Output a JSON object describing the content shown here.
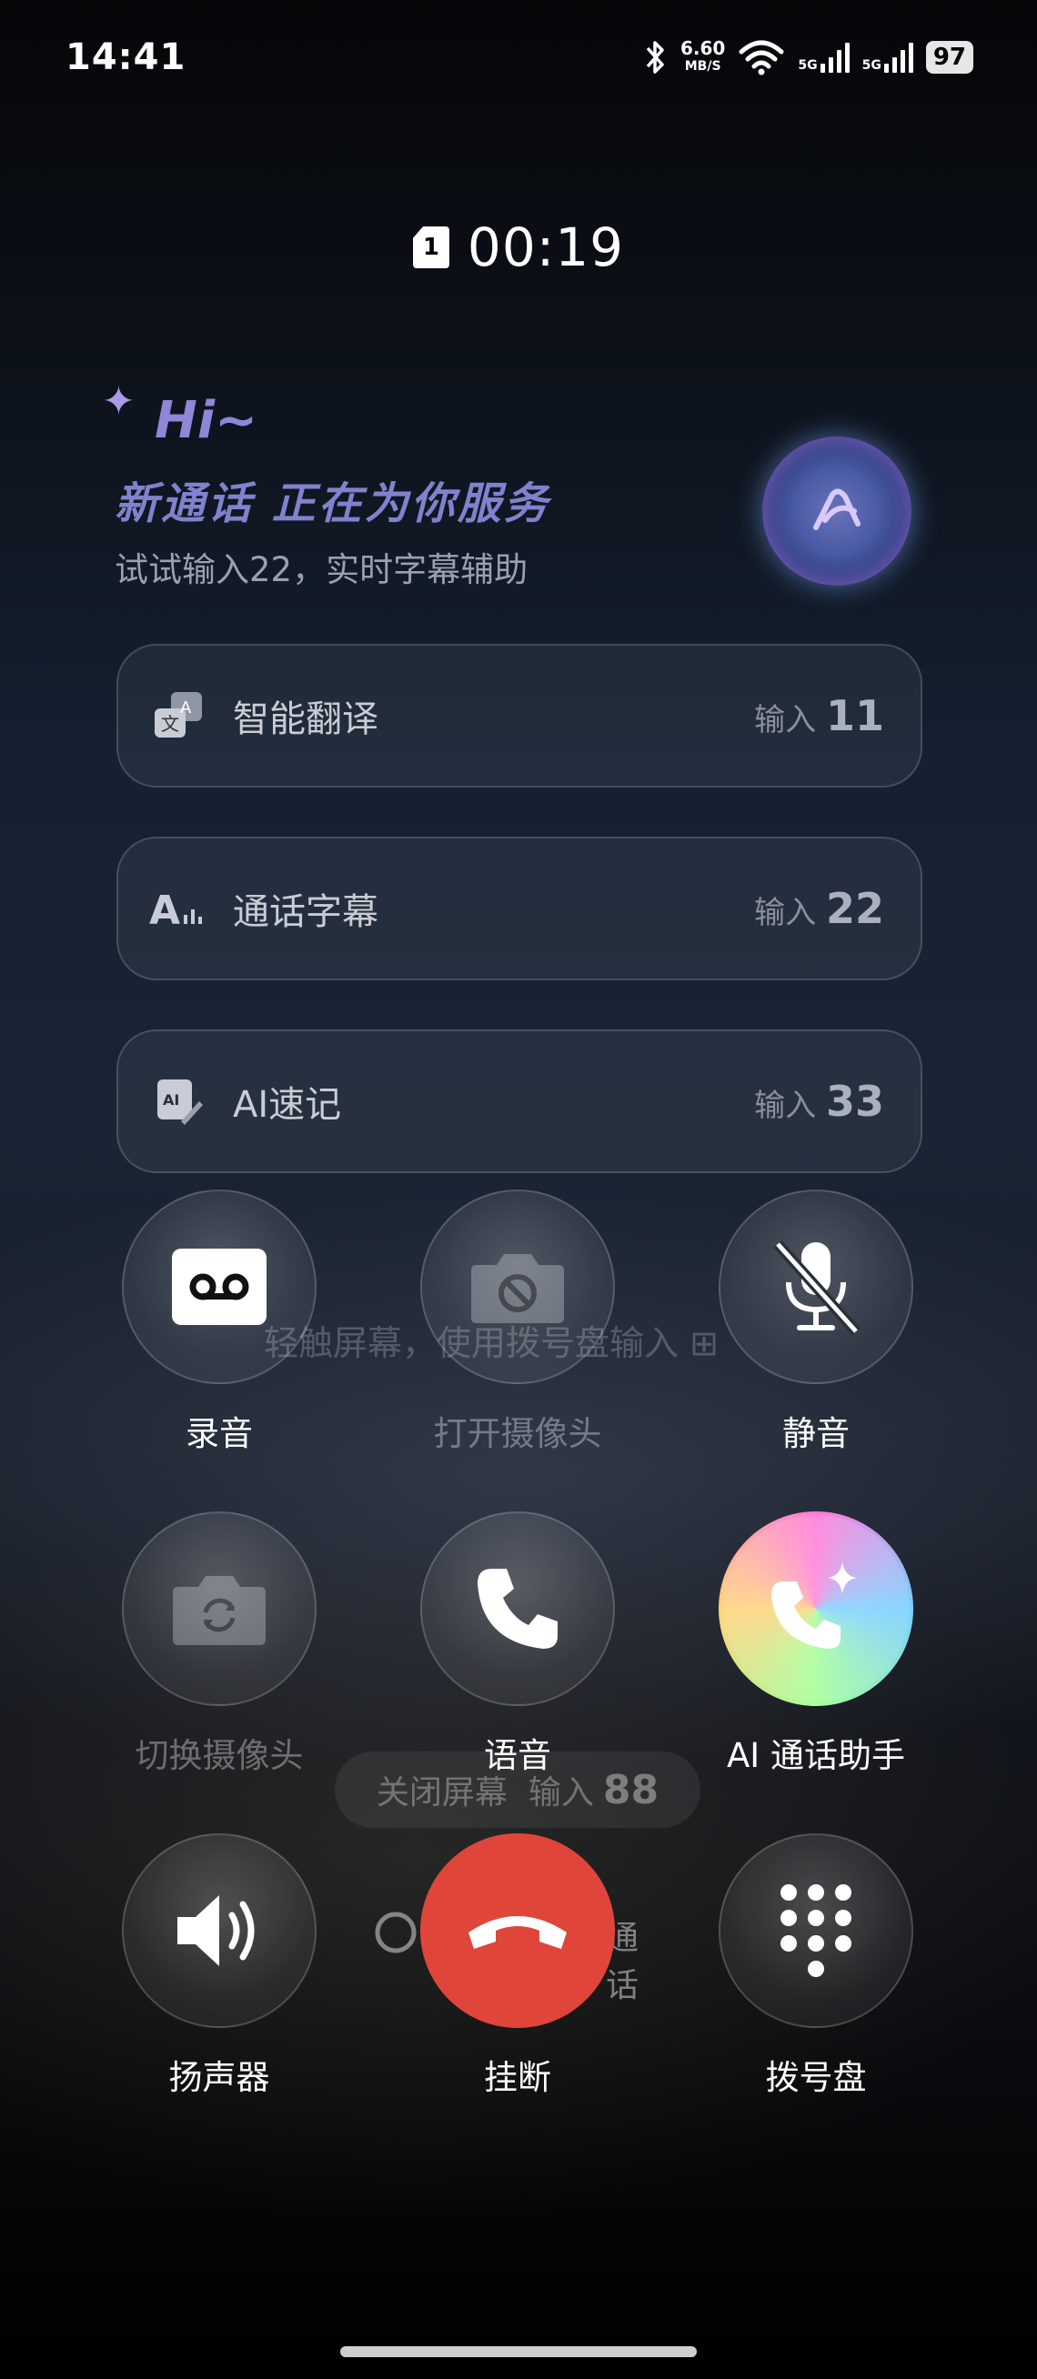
{
  "status_bar": {
    "time": "14:41",
    "net_speed": "6.60",
    "net_speed_unit": "MB/S",
    "sim1_type": "5G",
    "sim2_type": "5G",
    "battery": "97"
  },
  "call": {
    "sim_slot": "1",
    "duration": "00:19"
  },
  "assistant": {
    "greeting": "Hi~",
    "tagline": "新通话 正在为你服务",
    "hint": "试试输入22，实时字幕辅助"
  },
  "features": [
    {
      "label": "智能翻译",
      "code_prefix": "输入",
      "code": "11",
      "icon": "translate-icon"
    },
    {
      "label": "通话字幕",
      "code_prefix": "输入",
      "code": "22",
      "icon": "caption-icon"
    },
    {
      "label": "AI速记",
      "code_prefix": "输入",
      "code": "33",
      "icon": "ai-note-icon"
    }
  ],
  "background": {
    "dialpad_hint": "轻触屏幕，使用拨号盘输入",
    "close_screen_label": "关闭屏幕",
    "close_screen_prefix": "输入",
    "close_screen_code": "88",
    "carrier_text": "通话"
  },
  "controls": {
    "record": "录音",
    "open_camera": "打开摄像头",
    "mute": "静音",
    "switch_camera": "切换摄像头",
    "voice": "语音",
    "ai_assistant": "AI 通话助手",
    "speaker": "扬声器",
    "hangup": "挂断",
    "dialpad": "拨号盘"
  },
  "colors": {
    "hangup": "#e0453a",
    "accent": "#8e86d6"
  }
}
